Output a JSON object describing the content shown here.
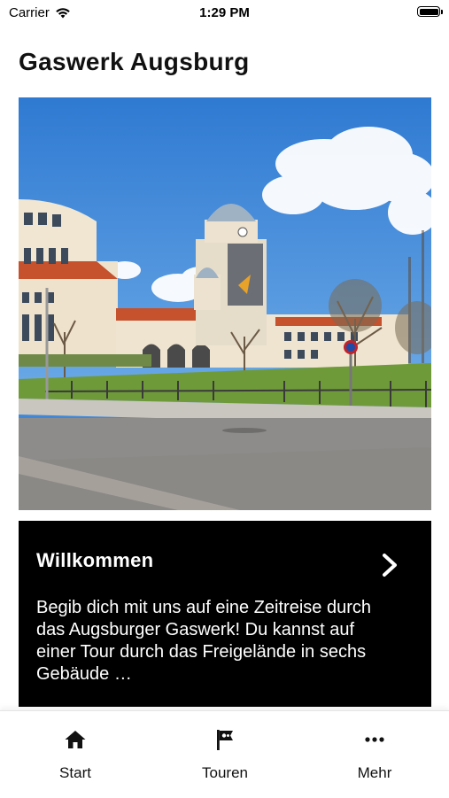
{
  "status_bar": {
    "carrier": "Carrier",
    "time": "1:29 PM",
    "icons": [
      "wifi-icon",
      "battery-icon"
    ]
  },
  "header": {
    "title": "Gaswerk Augsburg"
  },
  "hero_image": {
    "subject": "Gaswerk Augsburg building with tower"
  },
  "welcome_card": {
    "title": "Willkommen",
    "body": "Begib dich mit uns auf eine Zeitreise durch das Augsburger Gaswerk! Du kannst auf einer Tour durch das Freigelände in sechs Gebäude …",
    "icon": "chevron-right-icon"
  },
  "tab_bar": {
    "tabs": [
      {
        "label": "Start",
        "icon": "home-icon"
      },
      {
        "label": "Touren",
        "icon": "flag-icon"
      },
      {
        "label": "Mehr",
        "icon": "more-icon"
      }
    ]
  },
  "colors": {
    "card_background": "#000000",
    "card_text": "#ffffff",
    "sky": "#3f88d9"
  }
}
